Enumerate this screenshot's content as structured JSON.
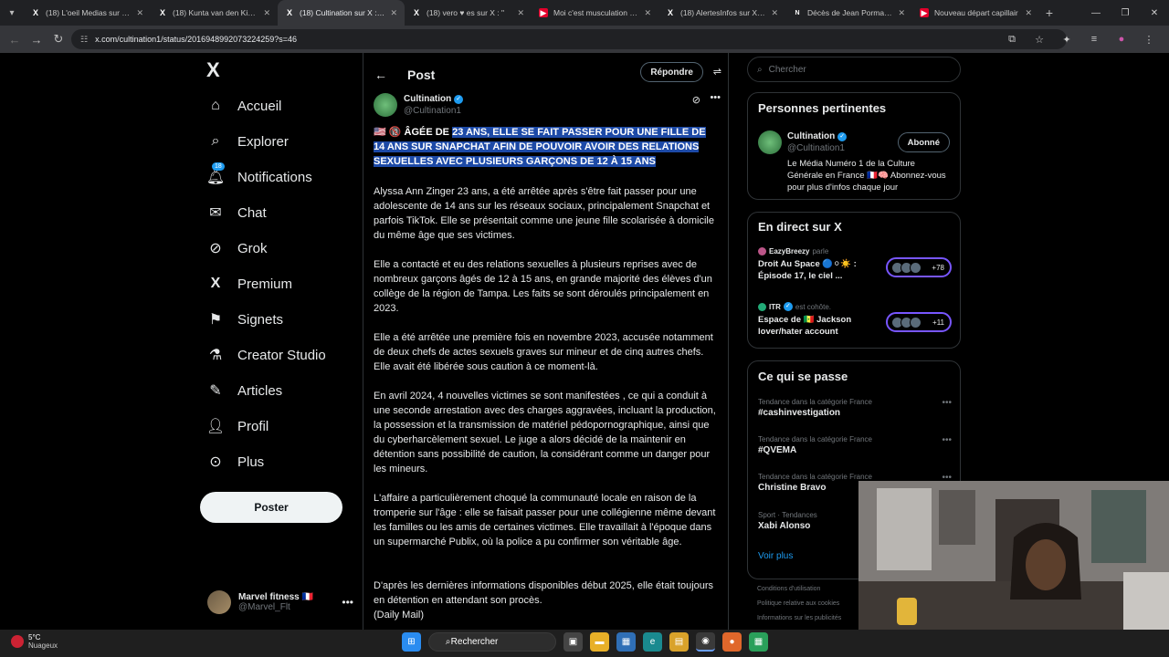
{
  "browser": {
    "tabs": [
      {
        "label": "(18) L'oeil Medias sur X : '",
        "icon": "x-logo-icon",
        "active": false
      },
      {
        "label": "(18) Kunta van den Kinté :",
        "icon": "x-logo-icon",
        "active": false
      },
      {
        "label": "(18) Cultination sur X : \"u",
        "icon": "x-logo-icon",
        "active": true
      },
      {
        "label": "(18) vero ♥ es sur X : \"",
        "icon": "x-logo-icon",
        "active": false
      },
      {
        "label": "Moi c'est musculation ma",
        "icon": "youtube-icon",
        "active": false
      },
      {
        "label": "(18) AlertesInfos sur X : \"",
        "icon": "x-logo-icon",
        "active": false
      },
      {
        "label": "Décès de Jean Pormanov",
        "icon": "news-icon",
        "active": false
      },
      {
        "label": "Nouveau départ capillair",
        "icon": "youtube-icon",
        "active": false
      }
    ],
    "url": "x.com/cultination1/status/2016948992073224259?s=46"
  },
  "nav": {
    "logo": "X",
    "items": [
      {
        "label": "Accueil",
        "icon": "home-icon"
      },
      {
        "label": "Explorer",
        "icon": "search-icon"
      },
      {
        "label": "Notifications",
        "icon": "bell-icon",
        "badge": "18"
      },
      {
        "label": "Chat",
        "icon": "mail-icon"
      },
      {
        "label": "Grok",
        "icon": "grok-icon"
      },
      {
        "label": "Premium",
        "icon": "x-logo-icon"
      },
      {
        "label": "Signets",
        "icon": "bookmark-icon"
      },
      {
        "label": "Creator Studio",
        "icon": "flask-icon"
      },
      {
        "label": "Articles",
        "icon": "article-icon"
      },
      {
        "label": "Profil",
        "icon": "person-icon"
      },
      {
        "label": "Plus",
        "icon": "more-circle-icon"
      }
    ],
    "post_button": "Poster",
    "account": {
      "name": "Marvel fitness 🇫🇷",
      "handle": "@Marvel_Flt"
    }
  },
  "post": {
    "header_title": "Post",
    "reply_button": "Répondre",
    "author": {
      "name": "Cultination",
      "handle": "@Cultination1"
    },
    "headline_prefix": "🇺🇸 🔞 ÂGÉE DE ",
    "headline_highlight": "23 ANS, ELLE SE FAIT PASSER POUR UNE FILLE DE 14 ANS SUR SNAPCHAT AFIN DE POUVOIR AVOIR DES RELATIONS SEXUELLES AVEC PLUSIEURS GARÇONS DE 12 À 15 ANS",
    "paragraphs": [
      "Alyssa Ann Zinger 23 ans, a été arrêtée après s'être fait passer pour une adolescente de 14 ans sur les réseaux sociaux, principalement Snapchat et parfois TikTok. Elle se présentait comme une jeune fille scolarisée à domicile du même âge que ses victimes.",
      "Elle a contacté et eu des relations sexuelles à plusieurs reprises avec de nombreux garçons âgés de 12 à 15 ans, en grande majorité des élèves d'un collège de la région de Tampa. Les faits se sont déroulés principalement en 2023.",
      "Elle a été arrêtée une première fois en novembre 2023, accusée notamment de deux chefs de actes sexuels graves sur mineur et de cinq autres chefs. Elle avait été libérée sous caution à ce moment-là.",
      "En avril 2024, 4 nouvelles victimes se sont manifestées , ce qui a conduit à une seconde arrestation avec des charges aggravées, incluant la production, la possession et la transmission de matériel pédopornographique, ainsi que du cyberharcèlement sexuel. Le juge a alors décidé de la maintenir en détention sans possibilité de caution, la considérant comme un danger pour les mineurs.",
      "L'affaire a particulièrement choqué la communauté locale en raison de la tromperie sur l'âge : elle se faisait passer pour une collégienne même devant les familles ou les amis de certaines victimes. Elle travaillait à l'époque dans un supermarché Publix, où la police a pu confirmer son véritable âge.",
      "D'après les dernières informations disponibles début 2025, elle était toujours en détention en attendant son procès.",
      "(Daily Mail)"
    ]
  },
  "sidebar": {
    "search_placeholder": "Chercher",
    "relevant": {
      "title": "Personnes pertinentes",
      "name": "Cultination",
      "handle": "@Cultination1",
      "button": "Abonné",
      "bio": "Le Média Numéro 1 de la Culture Générale en France 🇫🇷🧠 Abonnez-vous pour plus d'infos chaque jour"
    },
    "live": {
      "title": "En direct sur X",
      "spaces": [
        {
          "host": "EazyBreezy",
          "host_suffix": "parle",
          "title": "Droit Au Space 🔵⚪☀️ : Épisode 17, le ciel ...",
          "count": "+78"
        },
        {
          "host": "ITR",
          "host_suffix": "est cohôte.",
          "title": "Espace de 🇸🇳 Jackson lover/hater account",
          "count": "+11"
        }
      ]
    },
    "trends": {
      "title": "Ce qui se passe",
      "items": [
        {
          "category": "Tendance dans la catégorie France",
          "name": "#cashinvestigation"
        },
        {
          "category": "Tendance dans la catégorie France",
          "name": "#QVEMA"
        },
        {
          "category": "Tendance dans la catégorie France",
          "name": "Christine Bravo"
        },
        {
          "category": "Sport · Tendances",
          "name": "Xabi Alonso"
        }
      ],
      "see_more": "Voir plus"
    },
    "footer": [
      "Conditions d'utilisation",
      "Politique relative aux cookies",
      "Informations sur les publicités"
    ]
  },
  "taskbar": {
    "temperature": "5°C",
    "weather": "Nuageux",
    "search": "Rechercher"
  }
}
